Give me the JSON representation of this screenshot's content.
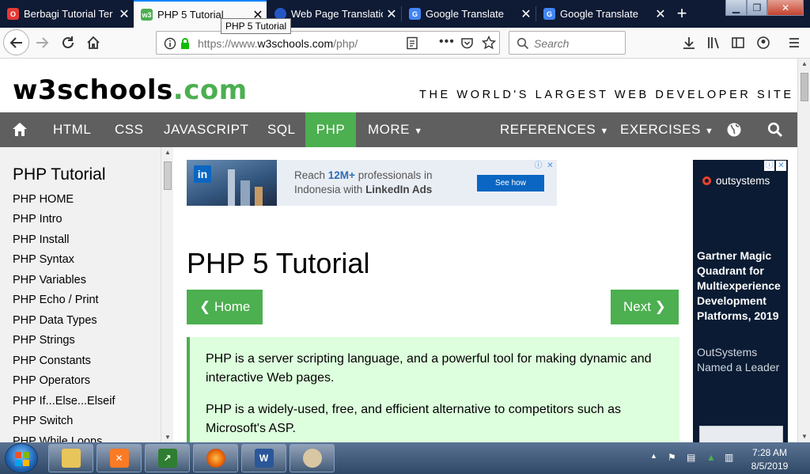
{
  "browser": {
    "tabs": [
      {
        "title": "Berbagi Tutorial Ter",
        "favicon": "opera-icon",
        "color": "#e53935"
      },
      {
        "title": "PHP 5 Tutorial",
        "favicon": "w3schools-icon",
        "color": "#4caf50"
      },
      {
        "title": "Web Page Translatio",
        "favicon": "globe-icon",
        "color": "#2457c5"
      },
      {
        "title": "Google Translate",
        "favicon": "google-translate-icon",
        "color": "#4285f4"
      },
      {
        "title": "Google Translate",
        "favicon": "google-translate-icon",
        "color": "#4285f4"
      }
    ],
    "active_tab_index": 1,
    "tooltip": "PHP 5 Tutorial",
    "url_prefix": "https://www.",
    "url_main": "w3schools.com",
    "url_suffix": "/php/",
    "search_placeholder": "Search",
    "accent": "#0a84ff"
  },
  "site": {
    "logo_main": "w3schools",
    "logo_tld": ".com",
    "tagline": "THE WORLD'S LARGEST WEB DEVELOPER SITE",
    "brand_green": "#4caf50",
    "nav": [
      "HTML",
      "CSS",
      "JAVASCRIPT",
      "SQL",
      "PHP",
      "MORE",
      "REFERENCES",
      "EXERCISES"
    ],
    "nav_active": "PHP"
  },
  "sidebar": {
    "title": "PHP Tutorial",
    "items": [
      "PHP HOME",
      "PHP Intro",
      "PHP Install",
      "PHP Syntax",
      "PHP Variables",
      "PHP Echo / Print",
      "PHP Data Types",
      "PHP Strings",
      "PHP Constants",
      "PHP Operators",
      "PHP If...Else...Elseif",
      "PHP Switch",
      "PHP While Loops"
    ]
  },
  "ad_banner": {
    "line1_pre": "Reach ",
    "line1_bold": "12M+",
    "line1_post": " professionals in",
    "line2_pre": "Indonesia with ",
    "line2_bold": "LinkedIn Ads",
    "button": "See how",
    "logo": "in"
  },
  "main": {
    "title": "PHP 5 Tutorial",
    "home_button": "❮ Home",
    "next_button": "Next ❯",
    "paragraphs": [
      "PHP is a server scripting language, and a powerful tool for making dynamic and interactive Web pages.",
      "PHP is a widely-used, free, and efficient alternative to competitors such as Microsoft's ASP."
    ]
  },
  "side_ad": {
    "brand": "outsystems",
    "headline": "Gartner Magic Quadrant for Multiexperience Development Platforms, 2019",
    "sub": "OutSystems Named a Leader"
  },
  "taskbar": {
    "apps": [
      "explorer-icon",
      "xampp-icon",
      "task-manager-icon",
      "firefox-icon",
      "word-icon",
      "paint-icon"
    ],
    "time": "7:28 AM",
    "date": "8/5/2019"
  }
}
